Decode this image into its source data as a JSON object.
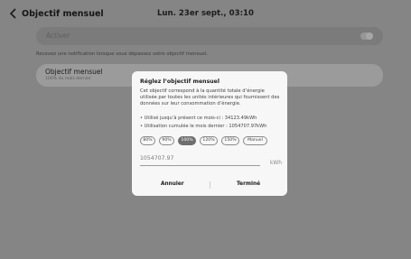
{
  "header": {
    "back_icon": "chevron-left-icon",
    "title": "Objectif mensuel",
    "datetime": "Lun. 23er sept., 03:10"
  },
  "activer": {
    "label": "Activer",
    "toggle_on": false
  },
  "help_text": "Recevez une notification lorsque vous dépassez votre objectif mensuel.",
  "objectif": {
    "title": "Objectif mensuel",
    "subtitle": "100% du mois dernier"
  },
  "dialog": {
    "title": "Réglez l’objectif mensuel",
    "description": "Cet objectif correspond à la quantité totale d’énergie utilisée par toutes les unités intérieures qui fournissent des données sur leur consommation d’énergie.",
    "bullet_used": "• Utilisé jusqu’à présent ce mois-ci : 34123.49kWh",
    "bullet_last": "• Utilisation cumulée le mois dernier : 1054707.97kWh",
    "chips": [
      "80%",
      "90%",
      "100%",
      "120%",
      "150%",
      "Manuel"
    ],
    "selected_chip": "100%",
    "input_value": "1054707.97",
    "unit": "kWh",
    "cancel_label": "Annuler",
    "done_label": "Terminé"
  }
}
